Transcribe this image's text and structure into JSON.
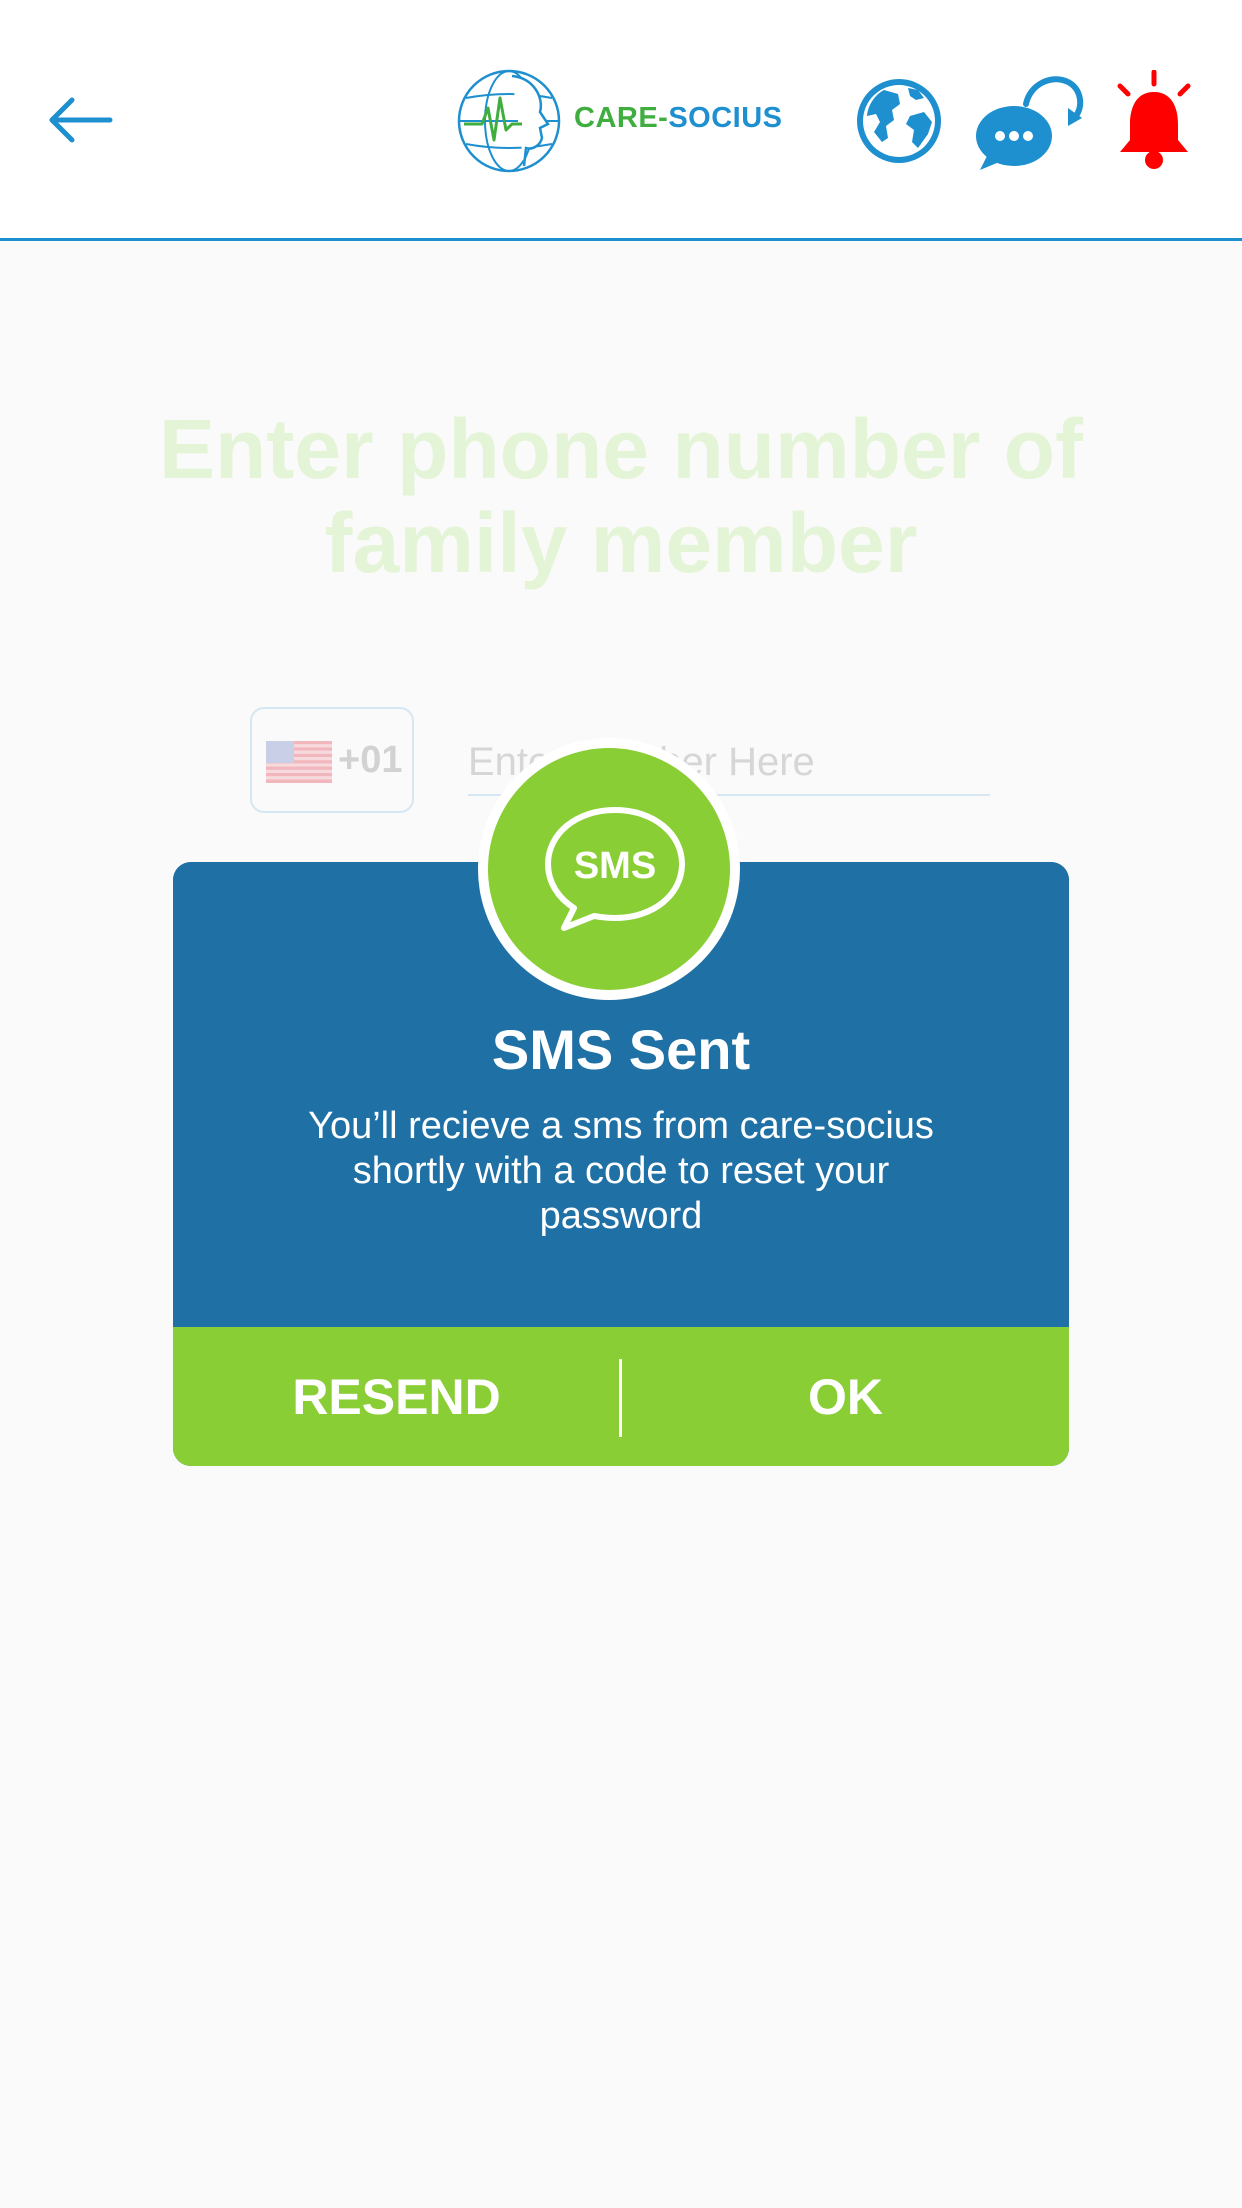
{
  "header": {
    "logo": {
      "word1": "CARE",
      "dash": "-",
      "word2": "SOCIUS"
    },
    "icons": [
      "back-arrow-icon",
      "globe-icon",
      "chat-bubbles-icon",
      "alarm-bell-icon"
    ],
    "colors": {
      "accent_blue": "#1e8fcf",
      "logo_green": "#3fae3f",
      "alert_red": "#ff0000"
    }
  },
  "form": {
    "title": "Enter phone number of family member",
    "country_code": "+01",
    "country_flag": "us-flag-icon",
    "phone_placeholder": "Enter Number Here"
  },
  "dialog": {
    "icon_label": "SMS",
    "title": "SMS Sent",
    "message": "You’ll recieve a sms from care-socius shortly with a code to reset your password",
    "buttons": {
      "resend": "RESEND",
      "ok": "OK"
    },
    "colors": {
      "body": "#1f70a5",
      "actions": "#8ace35"
    }
  }
}
